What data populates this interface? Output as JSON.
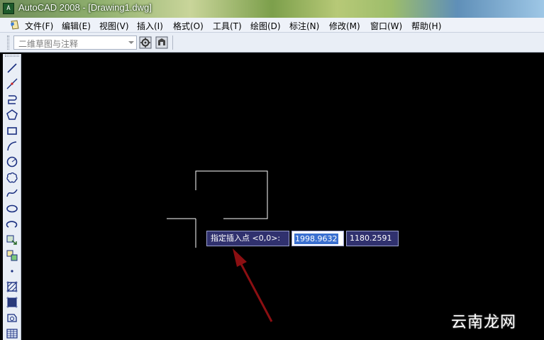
{
  "window": {
    "title": "AutoCAD 2008 - [Drawing1.dwg]",
    "app_icon": "autocad-logo-icon"
  },
  "menu": {
    "items": [
      "文件(F)",
      "编辑(E)",
      "视图(V)",
      "插入(I)",
      "格式(O)",
      "工具(T)",
      "绘图(D)",
      "标注(N)",
      "修改(M)",
      "窗口(W)",
      "帮助(H)"
    ]
  },
  "toolbar": {
    "workspace": "二维草图与注释",
    "buttons": [
      "workspace-settings-icon",
      "customize-icon"
    ]
  },
  "left_toolbar": {
    "tools": [
      "line-icon",
      "construction-line-icon",
      "polyline-icon",
      "polygon-icon",
      "rectangle-icon",
      "arc-icon",
      "circle-icon",
      "revision-cloud-icon",
      "spline-icon",
      "ellipse-icon",
      "ellipse-arc-icon",
      "insert-block-icon",
      "make-block-icon",
      "point-icon",
      "hatch-icon",
      "gradient-icon",
      "region-icon",
      "table-icon"
    ]
  },
  "dynamic_input": {
    "prompt": "指定插入点 <0,0>:",
    "x_value": "1998.9632",
    "y_value": "1180.2591"
  },
  "colors": {
    "canvas": "#000000",
    "prompt_bg": "#30316e",
    "selection": "#3a6fd0",
    "annotation_arrow": "#8b0f12"
  },
  "watermark": "云南龙网"
}
